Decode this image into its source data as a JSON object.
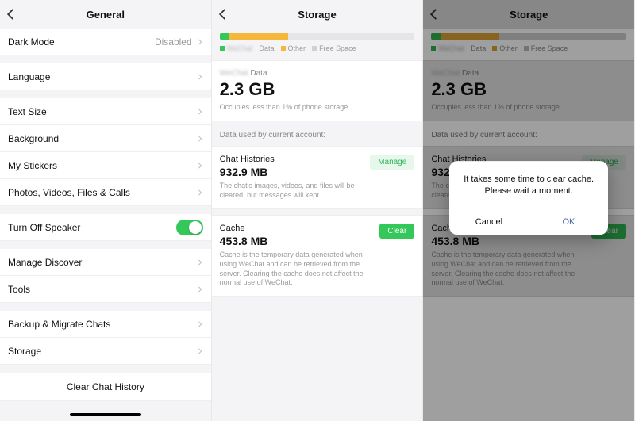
{
  "panel1": {
    "title": "General",
    "items": [
      "Dark Mode",
      "Language",
      "Text Size",
      "Background",
      "My Stickers",
      "Photos, Videos, Files & Calls",
      "Turn Off Speaker",
      "Manage Discover",
      "Tools",
      "Backup & Migrate Chats",
      "Storage"
    ],
    "dark_mode_value": "Disabled",
    "clear_history": "Clear Chat History"
  },
  "panel2": {
    "title": "Storage",
    "legend": {
      "a": "WeChat Data",
      "b": "Other",
      "c": "Free Space"
    },
    "data_label_suffix": "Data",
    "data_label_prefix": "WeChat",
    "total_size": "2.3 GB",
    "total_note": "Occupies less than 1% of phone storage",
    "section_label": "Data used by current account:",
    "chat": {
      "title": "Chat Histories",
      "size": "932.9 MB",
      "desc": "The chat's images, videos, and files will be cleared, but messages will kept.",
      "button": "Manage"
    },
    "cache": {
      "title": "Cache",
      "size": "453.8 MB",
      "desc": "Cache is the temporary data generated when using WeChat and can be retrieved from the server. Clearing the cache does not affect the normal use of WeChat.",
      "button": "Clear"
    },
    "bar": {
      "green_pct": 5,
      "orange_pct": 30,
      "free_pct": 65
    }
  },
  "panel3": {
    "alert_line1": "It takes some time to clear cache.",
    "alert_line2": "Please wait a moment.",
    "cancel": "Cancel",
    "ok": "OK"
  }
}
